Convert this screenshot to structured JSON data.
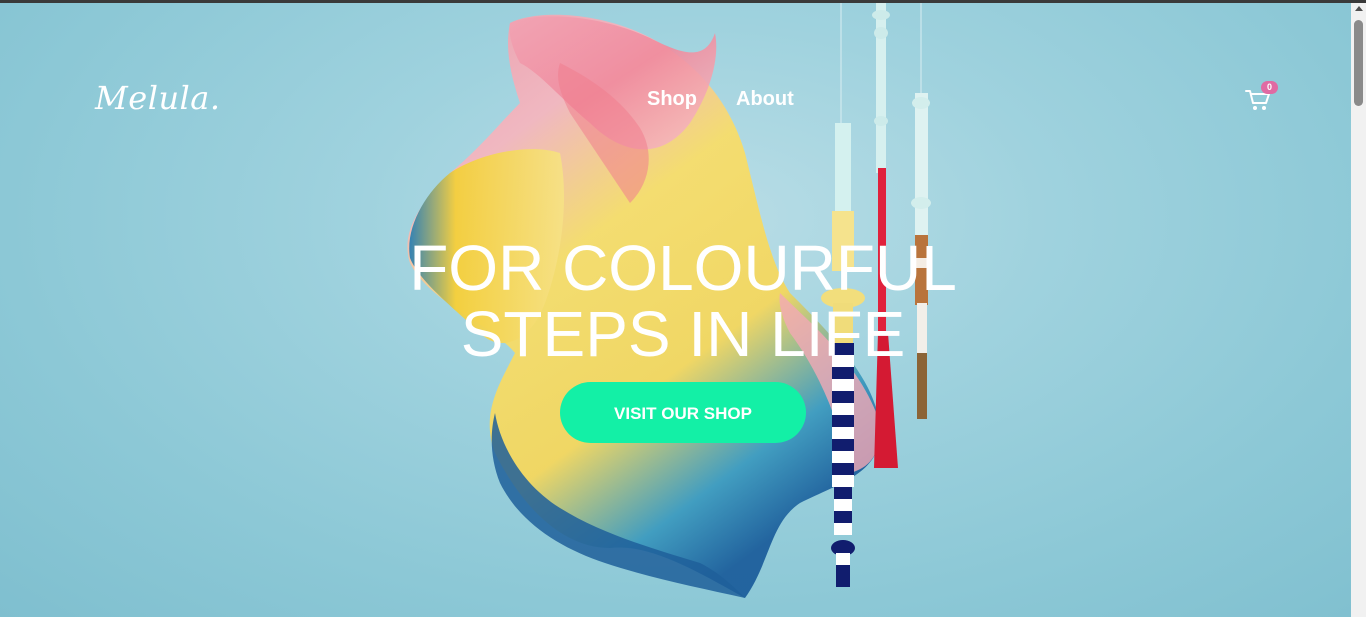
{
  "brand": {
    "logo_text": "Melula."
  },
  "nav": {
    "items": [
      {
        "label": "Shop"
      },
      {
        "label": "About"
      }
    ]
  },
  "cart": {
    "icon": "shopping-cart-icon",
    "count": "0"
  },
  "hero": {
    "headline_lines": [
      "FOR COLOURFUL",
      "STEPS IN LIFE"
    ],
    "cta_label": "VISIT OUR SHOP"
  },
  "colors": {
    "background": "#9fd2de",
    "accent": "#13f0a6",
    "badge": "#e06aa3",
    "text": "#ffffff"
  }
}
